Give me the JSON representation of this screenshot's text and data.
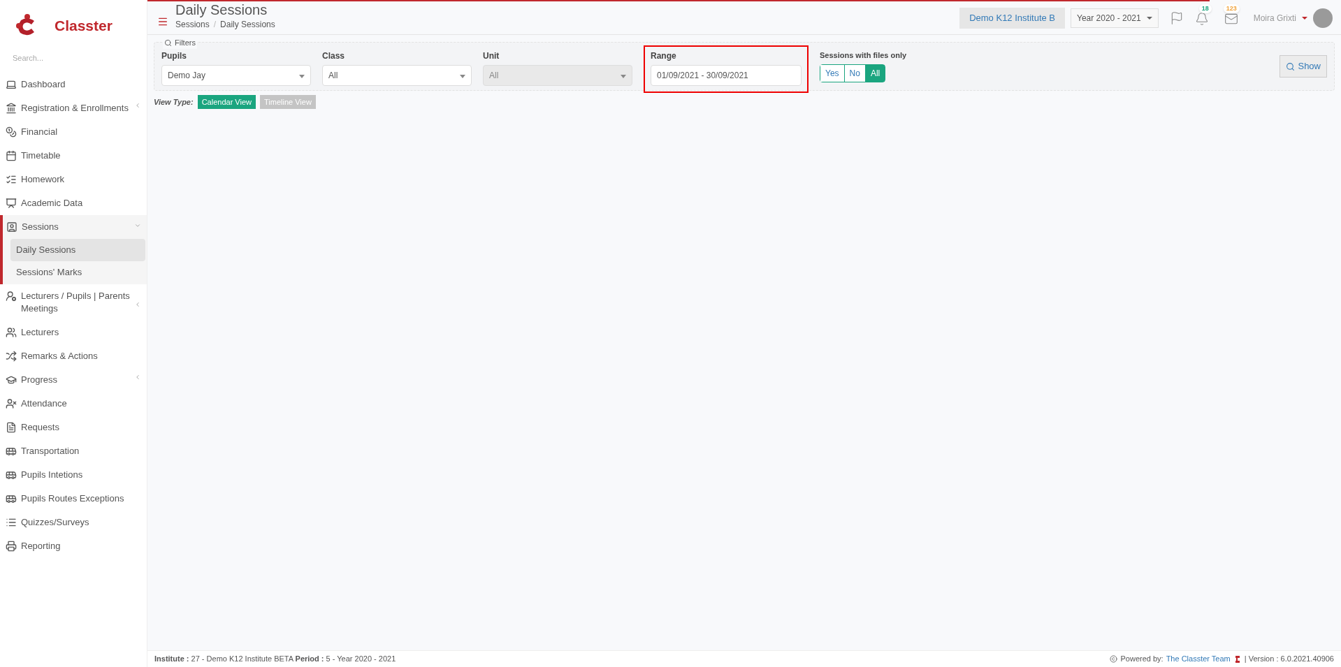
{
  "sidebar": {
    "logo_text": "Classter",
    "search_placeholder": "Search...",
    "items": [
      {
        "label": "Dashboard",
        "kind": "laptop",
        "expandable": false,
        "expanded": false
      },
      {
        "label": "Registration & Enrollments",
        "kind": "bank",
        "expandable": true,
        "expanded": false
      },
      {
        "label": "Financial",
        "kind": "coins",
        "expandable": false,
        "expanded": false
      },
      {
        "label": "Timetable",
        "kind": "calendar",
        "expandable": false,
        "expanded": false
      },
      {
        "label": "Homework",
        "kind": "checklist",
        "expandable": false,
        "expanded": false
      },
      {
        "label": "Academic Data",
        "kind": "presentation",
        "expandable": false,
        "expanded": false
      },
      {
        "label": "Sessions",
        "kind": "board",
        "expandable": true,
        "expanded": true,
        "children": [
          {
            "label": "Daily Sessions",
            "selected": true
          },
          {
            "label": "Sessions' Marks",
            "selected": false
          }
        ]
      },
      {
        "label": "Lecturers / Pupils | Parents Meetings",
        "kind": "user-clock",
        "expandable": true,
        "expanded": false
      },
      {
        "label": "Lecturers",
        "kind": "users",
        "expandable": false,
        "expanded": false
      },
      {
        "label": "Remarks & Actions",
        "kind": "shuffle",
        "expandable": false,
        "expanded": false
      },
      {
        "label": "Progress",
        "kind": "cap",
        "expandable": true,
        "expanded": false
      },
      {
        "label": "Attendance",
        "kind": "user-x",
        "expandable": false,
        "expanded": false
      },
      {
        "label": "Requests",
        "kind": "file",
        "expandable": false,
        "expanded": false
      },
      {
        "label": "Transportation",
        "kind": "bus",
        "expandable": false,
        "expanded": false
      },
      {
        "label": "Pupils Intetions",
        "kind": "bus",
        "expandable": false,
        "expanded": false
      },
      {
        "label": "Pupils Routes Exceptions",
        "kind": "bus",
        "expandable": false,
        "expanded": false
      },
      {
        "label": "Quizzes/Surveys",
        "kind": "list",
        "expandable": false,
        "expanded": false
      },
      {
        "label": "Reporting",
        "kind": "printer",
        "expandable": false,
        "expanded": false
      }
    ]
  },
  "header": {
    "title": "Daily Sessions",
    "breadcrumb": [
      "Sessions",
      "Daily Sessions"
    ],
    "breadcrumb_separator": "/",
    "institute": "Demo K12 Institute B",
    "year": "Year 2020 - 2021",
    "notifications": "18",
    "messages": "123",
    "user": "Moira Grixti"
  },
  "filters": {
    "legend": "Filters",
    "fields": [
      {
        "label": "Pupils",
        "kind": "select",
        "value": "Demo Jay",
        "disabled": false,
        "highlighted": false
      },
      {
        "label": "Class",
        "kind": "select",
        "value": "All",
        "disabled": false,
        "highlighted": false
      },
      {
        "label": "Unit",
        "kind": "select",
        "value": "All",
        "disabled": true,
        "highlighted": false
      },
      {
        "label": "Range",
        "kind": "text",
        "value": "01/09/2021 - 30/09/2021",
        "disabled": false,
        "highlighted": true
      }
    ],
    "files_only": {
      "label": "Sessions with files only",
      "options": [
        {
          "label": "Yes",
          "selected": false
        },
        {
          "label": "No",
          "selected": false
        },
        {
          "label": "All",
          "selected": true
        }
      ]
    },
    "show_button": "Show"
  },
  "view_type": {
    "label": "View Type:",
    "options": [
      {
        "label": "Calendar View",
        "selected": true
      },
      {
        "label": "Timeline View",
        "selected": false
      }
    ]
  },
  "footer": {
    "info": "**Institute :** 27 - Demo K12 Institute BETA **Period :** 5 - Year 2020 - 2021",
    "powered_by": "Powered by:",
    "team_link": "The Classter Team",
    "version": "| Version : 6.0.2021.40906"
  }
}
